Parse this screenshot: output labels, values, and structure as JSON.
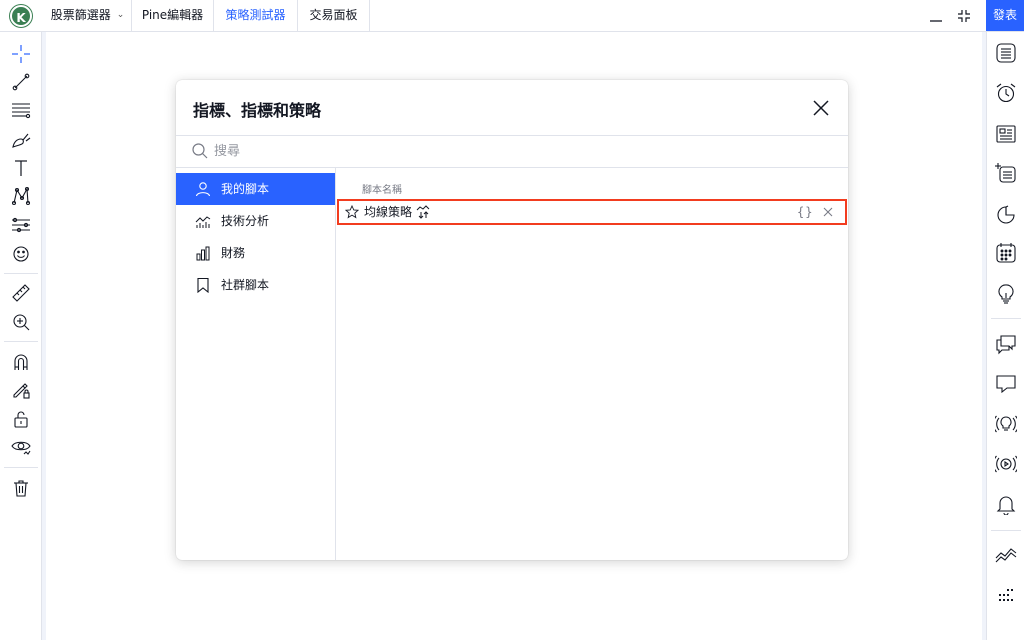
{
  "topbar": {
    "avatar_letter": "K",
    "tabs": [
      {
        "label": "股票篩選器",
        "has_dropdown": true,
        "active": false
      },
      {
        "label": "Pine編輯器",
        "has_dropdown": false,
        "active": false
      },
      {
        "label": "策略測試器",
        "has_dropdown": false,
        "active": true
      },
      {
        "label": "交易面板",
        "has_dropdown": false,
        "active": false
      }
    ],
    "minimize_icon": "minimize-icon",
    "collapse_icon": "collapse-icon",
    "publish_label": "發表"
  },
  "left_toolbar": {
    "icons": [
      "crosshair-icon",
      "trend-line-icon",
      "fib-lines-icon",
      "brush-icon",
      "text-icon",
      "pattern-icon",
      "forecast-icon",
      "emoji-icon",
      "ruler-icon",
      "zoom-in-icon",
      "magnet-icon",
      "lock-drawing-icon",
      "lock-icon",
      "eye-icon",
      "trash-icon"
    ]
  },
  "right_toolbar": {
    "icons": [
      "watchlist-icon",
      "alarm-icon",
      "news-icon",
      "new-list-icon",
      "pie-chart-icon",
      "calendar-icon",
      "lightbulb-icon",
      "chat-icon",
      "comment-icon",
      "broadcast-idea-icon",
      "stream-icon",
      "bell-icon",
      "chart-line-icon",
      "dots-grid-icon"
    ]
  },
  "dialog": {
    "title": "指標、指標和策略",
    "search_placeholder": "搜尋",
    "categories": [
      {
        "label": "我的腳本",
        "icon": "user-icon",
        "active": true
      },
      {
        "label": "技術分析",
        "icon": "technical-analysis-icon",
        "active": false
      },
      {
        "label": "財務",
        "icon": "financials-bar-icon",
        "active": false
      },
      {
        "label": "社群腳本",
        "icon": "bookmark-icon",
        "active": false
      }
    ],
    "column_header": "腳本名稱",
    "scripts": [
      {
        "name": "均線策略",
        "type_icon": "strategy-icon",
        "source_label": "{}"
      }
    ]
  },
  "colors": {
    "accent": "#2962ff",
    "highlight_border": "#f23c1f",
    "avatar_bg": "#3a7f53"
  }
}
